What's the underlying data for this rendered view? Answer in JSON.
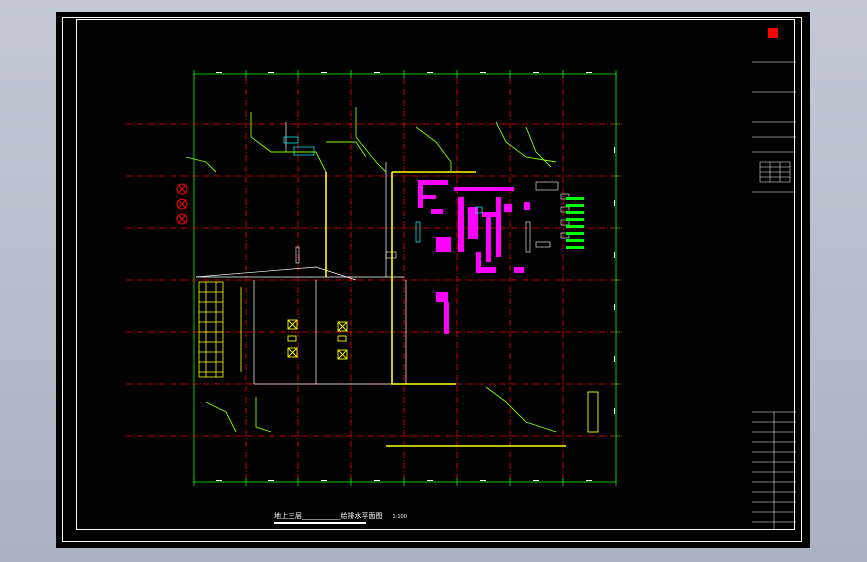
{
  "drawing": {
    "title": "地上三层___________给排水平面图",
    "scale": "1:100"
  },
  "title_block": {
    "company": "",
    "rows": []
  },
  "colors": {
    "background": "#000000",
    "grid_axis": "#ff0000",
    "dimension_line": "#00ff00",
    "wall": "#ffffff",
    "pipe_yellow": "#ffff00",
    "pipe_green": "#80ff00",
    "fixture_magenta": "#ff00ff",
    "fixture_cyan": "#00ffff",
    "title_block": "#ffffff"
  }
}
